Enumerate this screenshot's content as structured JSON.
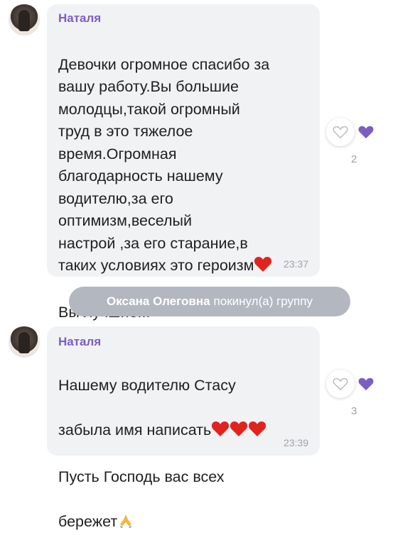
{
  "messages": [
    {
      "sender": "Наталя",
      "text": "Девочки огромное спасибо за\nвашу работу.Вы большие\nмолодцы,такой огромный\nтруд в это тяжелое\nвремя.Огромная\nблагодарность нашему\nводителю,за его\nоптимизм,веселый\nнастрой ,за его старание,в\nтаких условиях это героизм",
      "text_after": "Вы лучшие!!!",
      "time": "23:37",
      "reactions_count": "2"
    },
    {
      "sender": "Наталя",
      "line1": "Нашему водителю Стасу",
      "line2": "забыла имя написать",
      "line3": "Пусть Господь вас всех",
      "line4": "бережет",
      "time": "23:39",
      "reactions_count": "3"
    }
  ],
  "system": {
    "name": "Оксана Олеговна",
    "action": "покинул(а) группу"
  },
  "icons": {
    "avatar": "avatar-photo",
    "heart_empty": "heart-outline-icon",
    "heart_filled": "heart-filled-icon",
    "red_heart": "red-heart-emoji",
    "pray": "pray-emoji"
  },
  "colors": {
    "sender": "#7b5ec4",
    "bubble": "#f1f2f4",
    "reaction": "#7b5ec4",
    "system_pill": "#b3b8c0"
  }
}
